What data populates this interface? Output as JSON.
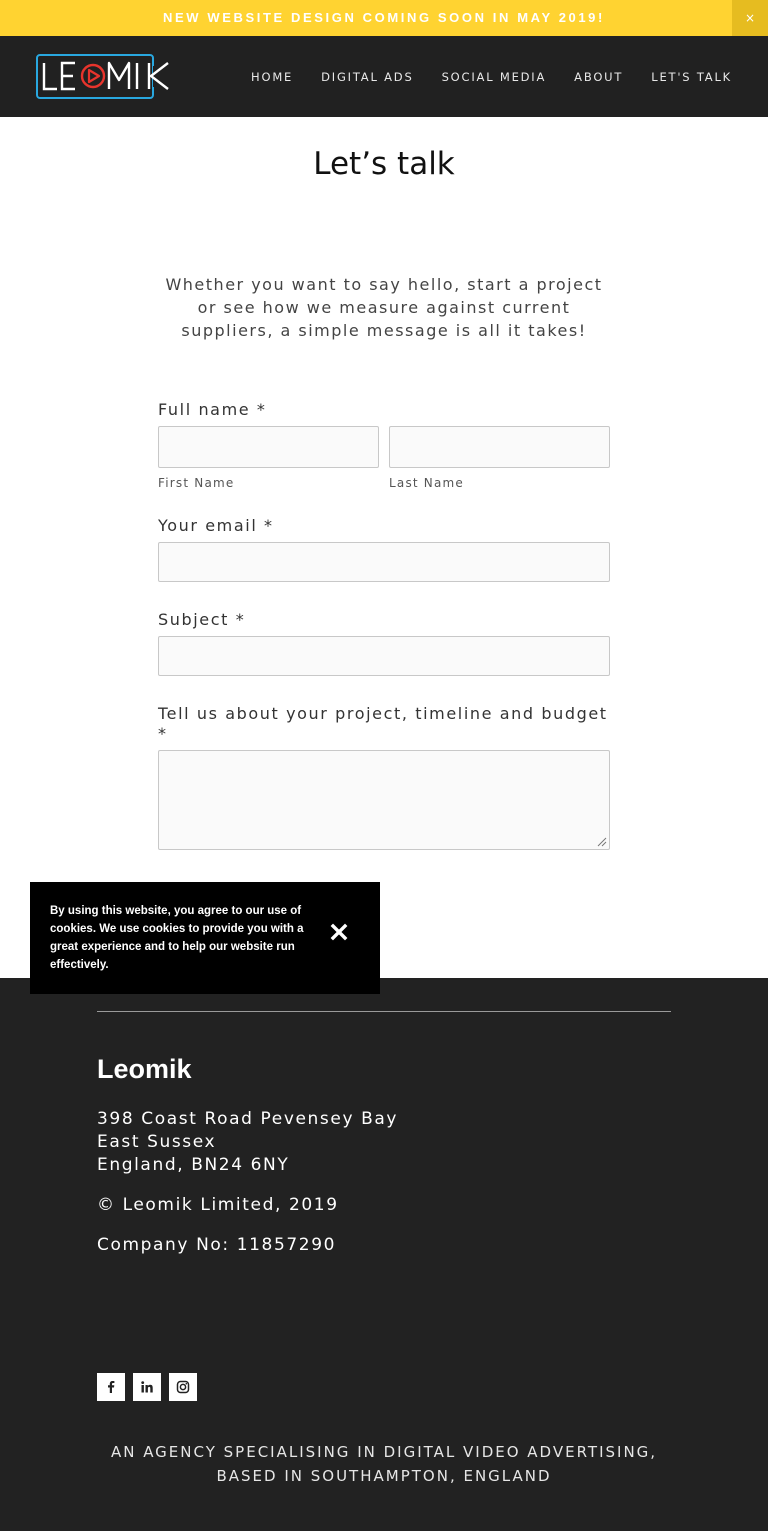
{
  "announcement": {
    "text": "NEW WEBSITE DESIGN COMING SOON IN MAY 2019!",
    "close_label": "×",
    "background": "#ffd331"
  },
  "header": {
    "logo_text": "LEOMIK",
    "logo_accent": "#e8342c",
    "logo_frame": "#29a8e0",
    "nav": [
      "HOME",
      "DIGITAL ADS",
      "SOCIAL MEDIA",
      "ABOUT",
      "LET'S TALK"
    ]
  },
  "main": {
    "title": "Let’s talk",
    "intro": "Whether you want to say hello, start a project or see how we measure against current suppliers, a simple message is all it takes!",
    "form": {
      "fullname_label": "Full name *",
      "first_name_label": "First Name",
      "last_name_label": "Last Name",
      "email_label": "Your email *",
      "subject_label": "Subject *",
      "message_label": "Tell us about your project, timeline and budget *"
    }
  },
  "cookie": {
    "text": "By using this website, you agree to our use of cookies. We use cookies to provide you with a great experience and to help our website run effectively.",
    "close_icon": "close-icon"
  },
  "footer": {
    "company": "Leomik",
    "address": [
      "398 Coast Road Pevensey Bay",
      "East Sussex",
      "England, BN24 6NY"
    ],
    "copyright": "© Leomik Limited, 2019",
    "company_no": "Company No: 11857290",
    "social": [
      "facebook-icon",
      "linkedin-icon",
      "instagram-icon"
    ],
    "tagline_1": "AN AGENCY SPECIALISING IN DIGITAL VIDEO ADVERTISING,",
    "tagline_2": "BASED IN SOUTHAMPTON, ENGLAND"
  }
}
